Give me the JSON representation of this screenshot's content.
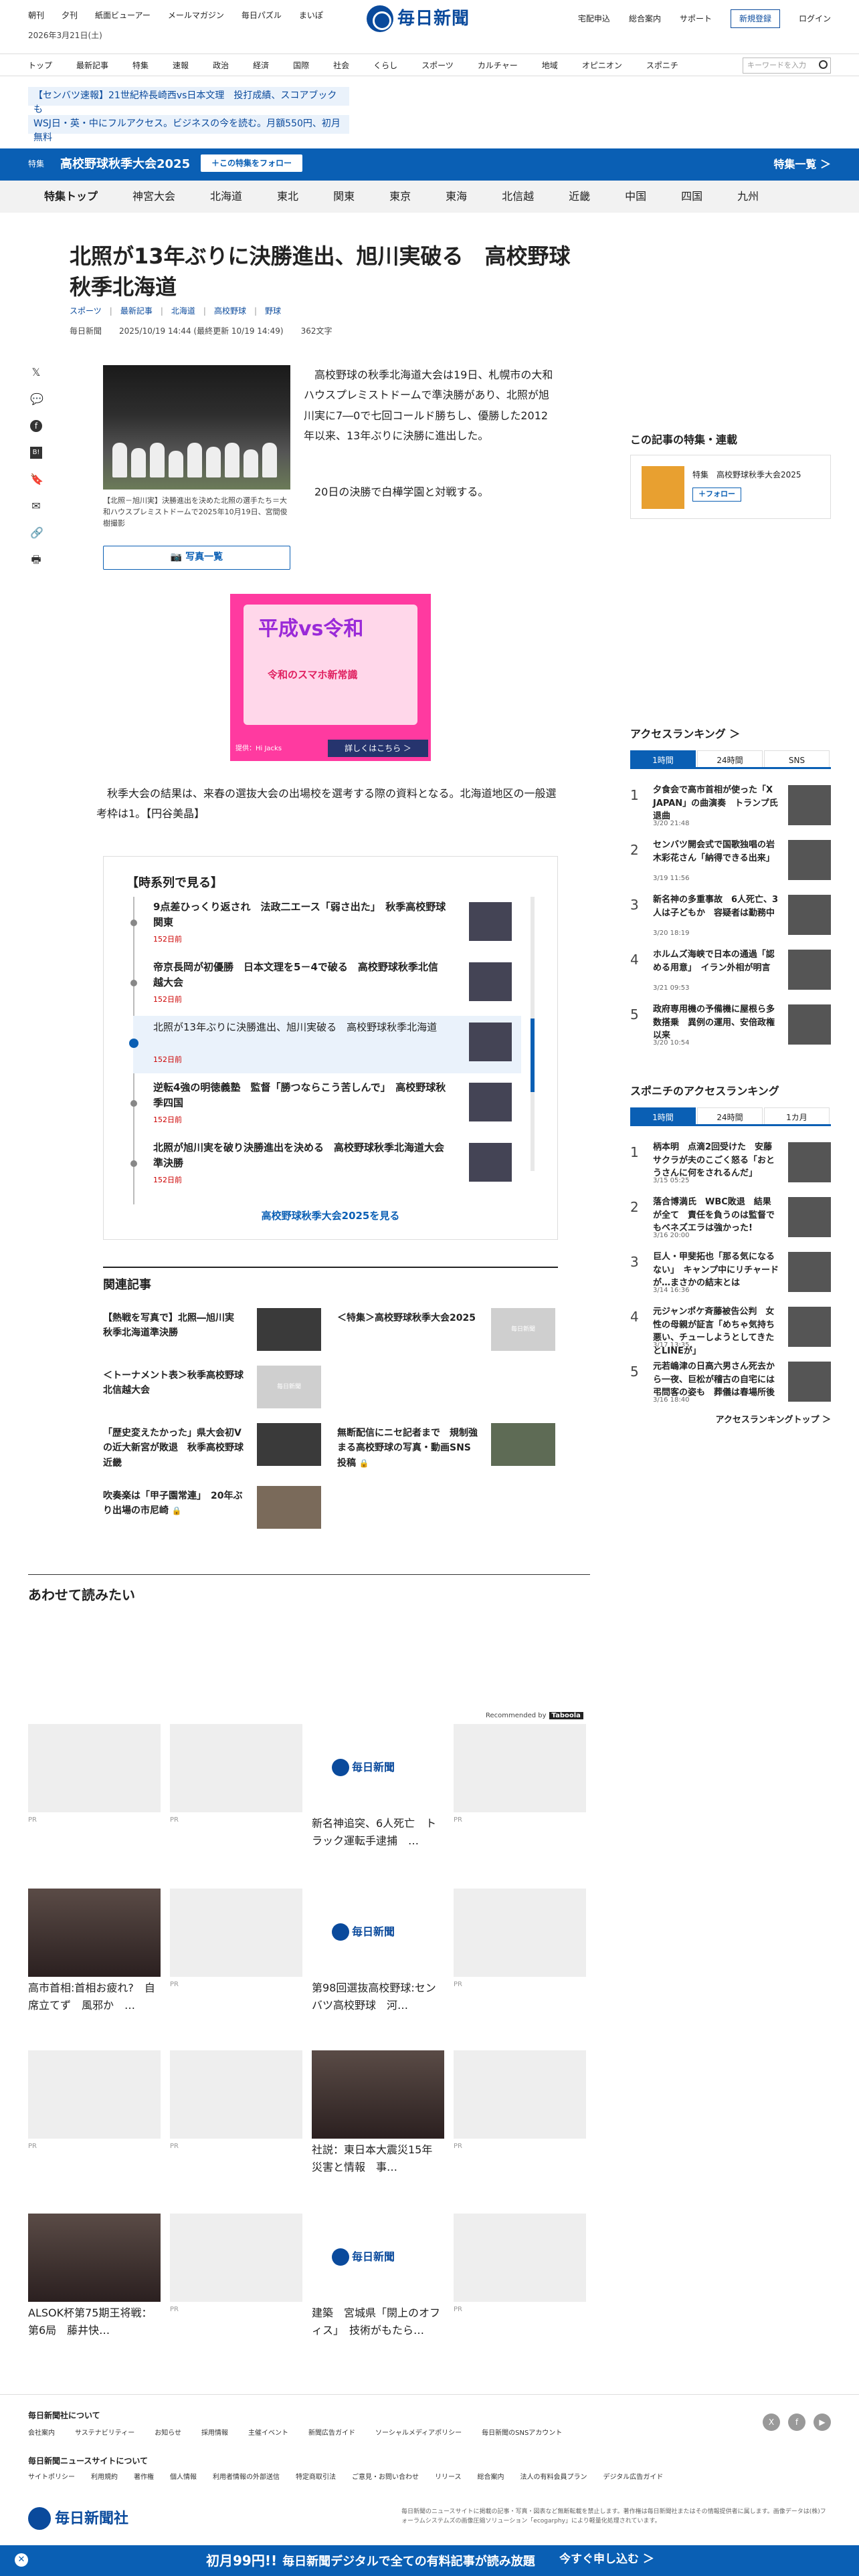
{
  "util": {
    "left": [
      "朝刊",
      "夕刊",
      "紙面ビューアー",
      "メールマガジン",
      "毎日パズル",
      "まいぽ"
    ],
    "date": "2026年3月21日(土)",
    "logo": "毎日新聞",
    "right": [
      "宅配申込",
      "総合案内",
      "サポート"
    ],
    "register": "新規登録",
    "login": "ログイン"
  },
  "nav": {
    "items": [
      "トップ",
      "最新記事",
      "特集",
      "速報",
      "政治",
      "経済",
      "国際",
      "社会",
      "くらし",
      "スポーツ",
      "カルチャー",
      "地域",
      "オピニオン",
      "スポニチ"
    ],
    "search_placeholder": "キーワードを入力"
  },
  "banners": [
    "【センバツ速報】21世紀枠長崎西vs日本文理　投打成績、スコアブックも",
    "WSJ日・英・中にフルアクセス。ビジネスの今を読む。月額550円、初月無料"
  ],
  "feature": {
    "tag": "特集",
    "title": "高校野球秋季大会2025",
    "follow": "＋この特集をフォロー",
    "all": "特集一覧 ＞"
  },
  "cats": [
    "特集トップ",
    "神宮大会",
    "北海道",
    "東北",
    "関東",
    "東京",
    "東海",
    "北信越",
    "近畿",
    "中国",
    "四国",
    "九州"
  ],
  "article": {
    "title": "北照が13年ぶりに決勝進出、旭川実破る　高校野球秋季北海道",
    "tags": [
      "スポーツ",
      "最新記事",
      "北海道",
      "高校野球",
      "野球"
    ],
    "source": "毎日新聞",
    "datetime": "2025/10/19 14:44 (最終更新 10/19 14:49)",
    "chars": "362文字",
    "caption": "【北照－旭川実】決勝進出を決めた北照の選手たち＝大和ハウスプレミストドームで2025年10月19日、宮間俊樹撮影",
    "photo_list": "写真一覧",
    "p1": "高校野球の秋季北海道大会は19日、札幌市の大和ハウスプレミストドームで準決勝があり、北照が旭川実に7―0で七回コールド勝ちし、優勝した2012年以来、13年ぶりに決勝に進出した。",
    "p2": "20日の決勝で白樺学園と対戦する。",
    "p3": "秋季大会の結果は、来春の選抜大会の出場校を選考する際の資料となる。北海道地区の一般選考枠は1。【円谷美晶】"
  },
  "ad": {
    "title": "平成vs令和",
    "sub": "令和のスマホ新常識",
    "by": "提供：Hi Jacks",
    "btn": "詳しくはこちら ＞"
  },
  "timeline": {
    "heading": "【時系列で見る】",
    "items": [
      {
        "title": "9点差ひっくり返され　法政二エース「弱さ出た」　秋季高校野球関東",
        "ago": "152日前"
      },
      {
        "title": "帝京長岡が初優勝　日本文理を5－4で破る　高校野球秋季北信越大会",
        "ago": "152日前"
      },
      {
        "title": "北照が13年ぶりに決勝進出、旭川実破る　高校野球秋季北海道",
        "ago": "152日前"
      },
      {
        "title": "逆転4強の明徳義塾　監督「勝つならこう苦しんで」　高校野球秋季四国",
        "ago": "152日前"
      },
      {
        "title": "北照が旭川実を破り決勝進出を決める　高校野球秋季北海道大会準決勝",
        "ago": "152日前"
      }
    ],
    "more": "高校野球秋季大会2025を見る"
  },
  "related": {
    "heading": "関連記事",
    "items": [
      {
        "title": "【熱戦を写真で】北照―旭川実　秋季北海道準決勝",
        "img": "photo"
      },
      {
        "title": "＜特集＞高校野球秋季大会2025",
        "img": "gray"
      },
      {
        "title": "＜トーナメント表＞秋季高校野球北信越大会",
        "img": "gray"
      },
      {
        "title": "",
        "img": "none"
      },
      {
        "title": "「歴史変えたかった」県大会初Vの近大新宮が敗退　秋季高校野球近畿",
        "img": "photo"
      },
      {
        "title": "無断配信にニセ記者まで　規制強まる高校野球の写真・動画SNS投稿",
        "img": "photo"
      },
      {
        "title": "吹奏楽は「甲子園常連」　20年ぶり出場の市尼崎",
        "img": "photo"
      }
    ],
    "gray_label": "毎日新聞"
  },
  "also": {
    "heading": "あわせて読みたい",
    "recommended": "Recommended by",
    "taboola": "Taboola",
    "pr": "PR",
    "cards": [
      {
        "title": "",
        "img": "gray"
      },
      {
        "title": "",
        "img": "gray"
      },
      {
        "title": "新名神追突、6人死亡　トラック運転手逮捕　…",
        "img": "logo"
      },
      {
        "title": "",
        "img": "gray"
      },
      {
        "title": "高市首相:首相お疲れ?　自席立てず　風邪か　…",
        "img": "dark"
      },
      {
        "title": "",
        "img": "gray"
      },
      {
        "title": "第98回選抜高校野球:センバツ高校野球　河…",
        "img": "logo"
      },
      {
        "title": "",
        "img": "gray"
      },
      {
        "title": "",
        "img": "gray"
      },
      {
        "title": "",
        "img": "gray"
      },
      {
        "title": "社説：東日本大震災15年　災害と情報　事…",
        "img": "dark"
      },
      {
        "title": "",
        "img": "gray"
      },
      {
        "title": "ALSOK杯第75期王将戦：第6局　藤井快…",
        "img": "dark"
      },
      {
        "title": "",
        "img": "gray"
      },
      {
        "title": "建築　宮城県「閖上のオフィス」　技術がもたら…",
        "img": "logo"
      },
      {
        "title": "",
        "img": "gray"
      }
    ]
  },
  "sidebar": {
    "feature_heading": "この記事の特集・連載",
    "feature_tag": "特集",
    "feature_title": "高校野球秋季大会2025",
    "feature_follow": "＋フォロー",
    "ranking_heading": "アクセスランキング ＞",
    "tabs1": [
      "1時間",
      "24時間",
      "SNS"
    ],
    "ranking": [
      {
        "n": "1",
        "t": "夕食会で高市首相が使った「X JAPAN」の曲演奏　トランプ氏退曲",
        "d": "3/20 21:48"
      },
      {
        "n": "2",
        "t": "センバツ開会式で国歌独唱の岩木彩花さん「納得できる出来」",
        "d": "3/19 11:56"
      },
      {
        "n": "3",
        "t": "新名神の多重事故　6人死亡、3人は子どもか　容疑者は勤務中",
        "d": "3/20 18:19"
      },
      {
        "n": "4",
        "t": "ホルムズ海峡で日本の通過「認める用意」　イラン外相が明言",
        "d": "3/21 09:53"
      },
      {
        "n": "5",
        "t": "政府専用機の予備機に屋根ら多数搭乗　異例の運用、安倍政権以来",
        "d": "3/20 10:54"
      }
    ],
    "sponichi_heading": "スポニチのアクセスランキング",
    "tabs2": [
      "1時間",
      "24時間",
      "1カ月"
    ],
    "sponichi": [
      {
        "n": "1",
        "t": "柄本明　点滴2回受けた　安藤サクラが夫のこごく怒る「おとうさんに何をされるんだ」",
        "d": "3/15 05:25"
      },
      {
        "n": "2",
        "t": "落合博満氏　WBC敗退　結果が全て　責任を負うのは監督でもベネズエラは強かった!",
        "d": "3/16 20:00"
      },
      {
        "n": "3",
        "t": "巨人・甲斐拓也「那る気になるない」　キャンプ中にリチャードが…まさかの結末とは",
        "d": "3/14 16:36"
      },
      {
        "n": "4",
        "t": "元ジャンポケ斉藤被告公判　女性の母親が証言「めちゃ気持ち悪い、チューしようとしてきたとLINEが」",
        "d": "3/17 13:35"
      },
      {
        "n": "5",
        "t": "元若嶋津の日高六男さん死去から一夜、巨松が稽古の自宅には弔問客の姿も　葬儀は春場所後",
        "d": "3/16 18:40"
      }
    ],
    "ranking_more": "アクセスランキングトップ ＞"
  },
  "footer": {
    "about": "毎日新聞社について",
    "links1": [
      "会社案内",
      "サステナビリティー",
      "お知らせ",
      "採用情報",
      "主催イベント",
      "新聞広告ガイド",
      "ソーシャルメディアポリシー",
      "毎日新聞のSNSアカウント"
    ],
    "sites": "毎日新聞ニュースサイトについて",
    "links2": [
      "サイトポリシー",
      "利用規約",
      "著作権",
      "個人情報",
      "利用者情報の外部送信",
      "特定商取引法",
      "ご意見・お問い合わせ",
      "リリース",
      "総合案内",
      "法人の有料会員プラン",
      "デジタル広告ガイド"
    ],
    "sns": [
      "X",
      "f",
      "▶"
    ],
    "company": "毎日新聞社",
    "note": "毎日新聞のニュースサイトに掲載の記事・写真・図表など無断転載を禁止します。著作権は毎日新聞社またはその情報提供者に属します。画像データは(株)フォーラムシステムズの画像圧縮ソリューション「ecogarphy」により軽量化処理されています。"
  },
  "cta": {
    "main": "初月99円!!",
    "sub": "毎日新聞デジタルで全ての有料記事が読み放題",
    "button": "今すぐ申し込む ＞"
  }
}
